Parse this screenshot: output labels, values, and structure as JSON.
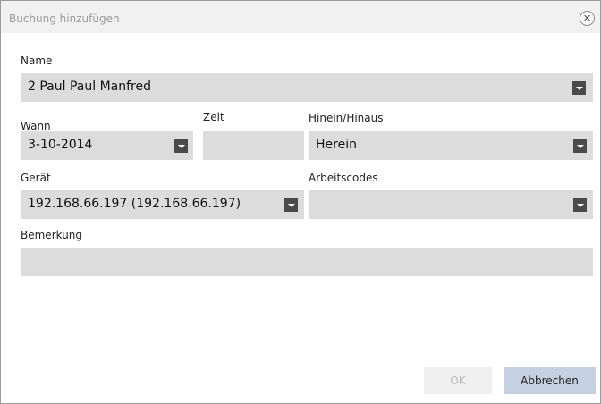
{
  "dialog": {
    "title": "Buchung hinzufügen",
    "close_glyph": "✕"
  },
  "name": {
    "label": "Name",
    "value": "2 Paul Paul Manfred"
  },
  "wann": {
    "label": "Wann",
    "value": "3-10-2014"
  },
  "zeit": {
    "label": "Zeit",
    "value": ""
  },
  "hinein": {
    "label": "Hinein/Hinaus",
    "value": "Herein"
  },
  "geraet": {
    "label": "Gerät",
    "value": "192.168.66.197 (192.168.66.197)"
  },
  "arbeitscodes": {
    "label": "Arbeitscodes",
    "value": ""
  },
  "bemerkung": {
    "label": "Bemerkung",
    "value": ""
  },
  "buttons": {
    "ok": "OK",
    "cancel": "Abbrechen"
  },
  "colors": {
    "field_bg": "#dcdcdc",
    "dropdown_arrow_bg": "#4a4a4a",
    "cancel_bg": "#c5d1e0"
  },
  "icons": {
    "close": "close-icon",
    "dropdown": "chevron-down-icon"
  }
}
